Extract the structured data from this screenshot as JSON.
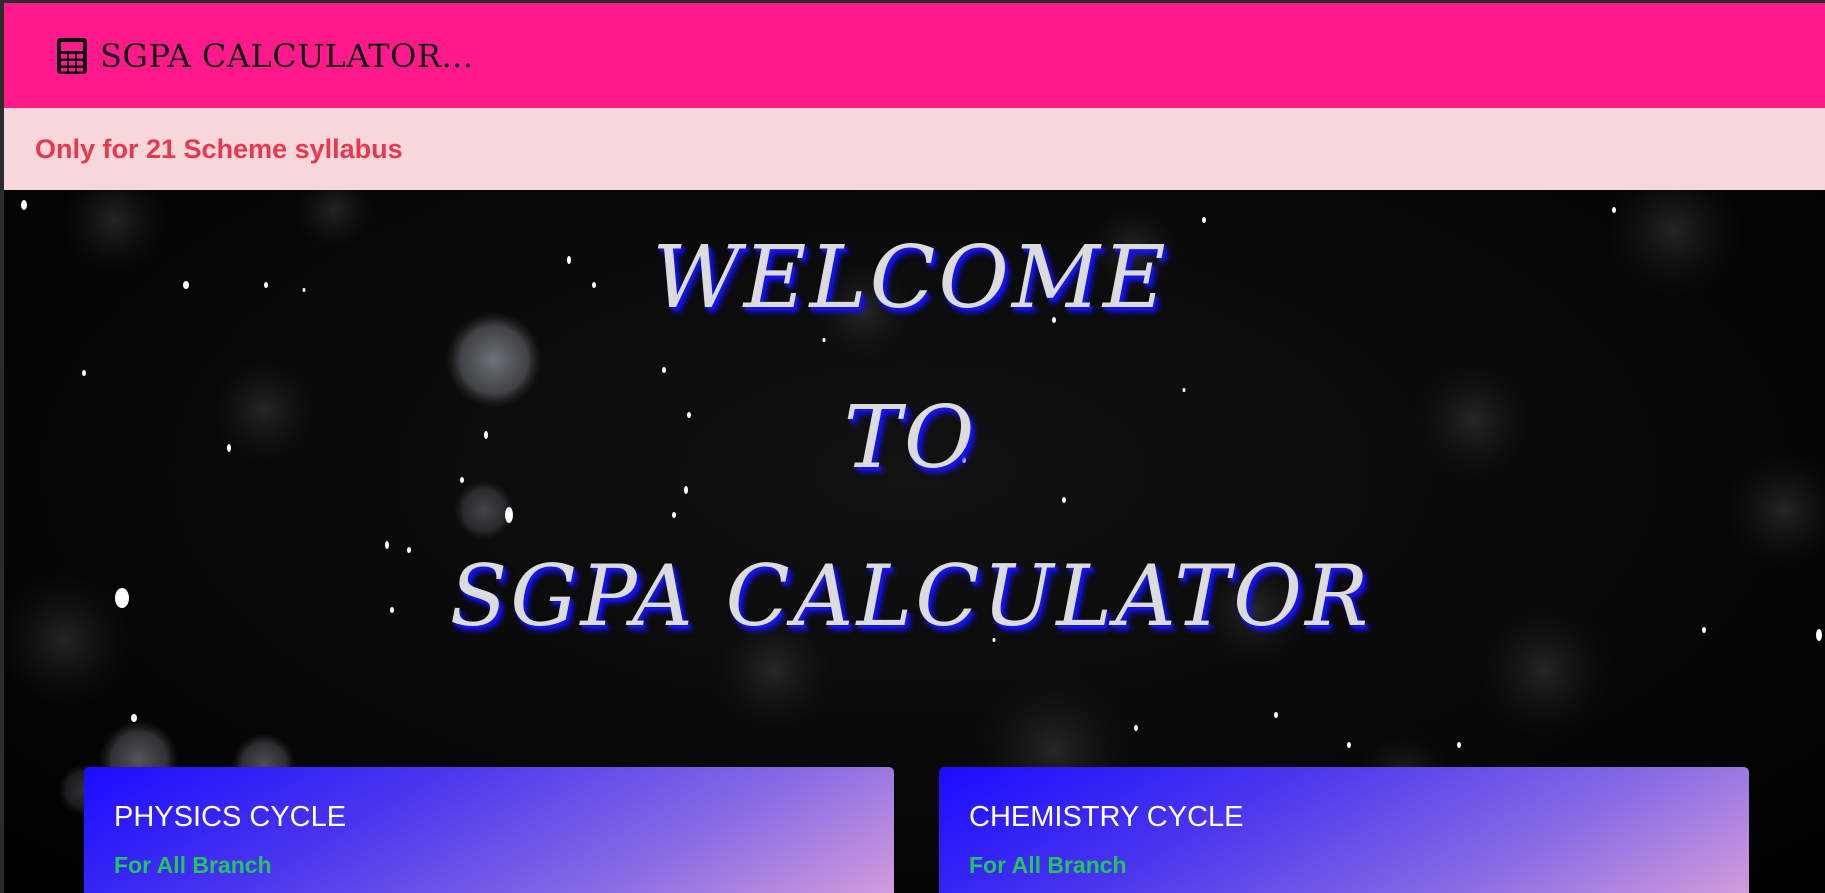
{
  "navbar": {
    "brand_icon": "calculator-icon",
    "brand_text": "SGPA CALCULATOR...",
    "background": "#ff1a8c"
  },
  "alert": {
    "text": "Only for 21 Scheme syllabus",
    "background": "#f8d7da",
    "text_color": "#e8384f"
  },
  "hero": {
    "line1": "WELCOME",
    "line2": "TO",
    "line3": "SGPA CALCULATOR",
    "text_color": "#dcdcdc",
    "shadow_color": "#1010ff"
  },
  "cards": [
    {
      "title": "PHYSICS CYCLE",
      "subtitle": "For All Branch"
    },
    {
      "title": "CHEMISTRY CYCLE",
      "subtitle": "For All Branch"
    }
  ],
  "colors": {
    "card_gradient_start": "#1a0cff",
    "card_gradient_end": "#d8a0dc",
    "subtitle_green": "#22c55e"
  }
}
